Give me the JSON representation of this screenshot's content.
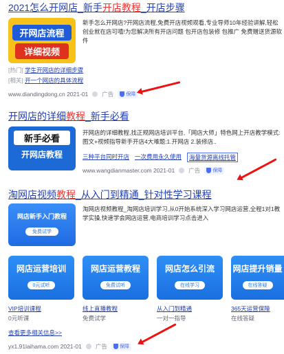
{
  "result1": {
    "title_a": "2021怎么开网店_新手",
    "title_hl": "开店教程",
    "title_b": "_开店步骤",
    "thumb_line1": "开网店流程",
    "thumb_line2": "详细视频",
    "desc": "新手怎么开网店?开网店流程,免费开店视频观看,专业导师10年经验讲解,轻松创业就在店可嘻!为您解决所有开店问题 包开店包装修 包推广 免费赠送货源软件",
    "related_1_tag": "[热门]",
    "related_1_link": "学生开网店的详细步骤",
    "related_2_tag": "[相关]",
    "related_2_link": "开一个网店的具体流程",
    "url": "www.diandingdong.cn",
    "date": "2021-01",
    "ad": "广告",
    "badge": "保障"
  },
  "result2": {
    "title_a": "开网店的详细",
    "title_hl": "教程",
    "title_b": "_新手必看",
    "thumb_line1": "新手必看",
    "thumb_line2": "开网店教程",
    "desc": "开网店的详细教程,找正规网店培训平台,「网店大师」特色网上开店教学模式:图文+视频指导新手开店4大难题:1.开网店 2.装修店..",
    "sublink_1": "三种平台同时开店",
    "sublink_2": "一次费用永久使用",
    "sublink_3": "海量货源离线托管",
    "url": "www.wangdianmaster.com",
    "date": "2021-01",
    "ad": "广告",
    "badge": "保障"
  },
  "result3": {
    "title_a": "淘网店视频",
    "title_hl": "教程",
    "title_b": "_从入门到精通_针对性学习课程",
    "thumb_title": "网店新手入门教程",
    "thumb_btn": "免费试学",
    "desc": "淘网店视频教程_淘网店培训学习,从0开始系统深入学习网店运营,全程1对1教学实操,快速学会网店运营,电商培训学习点击进入",
    "cards": [
      {
        "title": "网店运营培训",
        "btn": "0元试听",
        "l1": "VIP培训课程",
        "l2": "0元听课"
      },
      {
        "title": "网店运营教程",
        "btn": "免费试听",
        "l1": "线上直播教程",
        "l2": "免费试学"
      },
      {
        "title": "网店怎么引流",
        "btn": "在线学习",
        "l1": "从入门到精通",
        "l2": "一对一指导"
      },
      {
        "title": "网店提升销量",
        "btn": "在线答疑",
        "l1": "365天运营保障",
        "l2": "在线答疑"
      }
    ],
    "more": "查看更多相关信息>>",
    "url": "yx1.91laihama.com",
    "date": "2021-01",
    "ad": "广告",
    "badge": "保障"
  },
  "colors": {
    "link": "#2440b3",
    "highlight": "#f73131",
    "arrow": "#ee1111"
  }
}
